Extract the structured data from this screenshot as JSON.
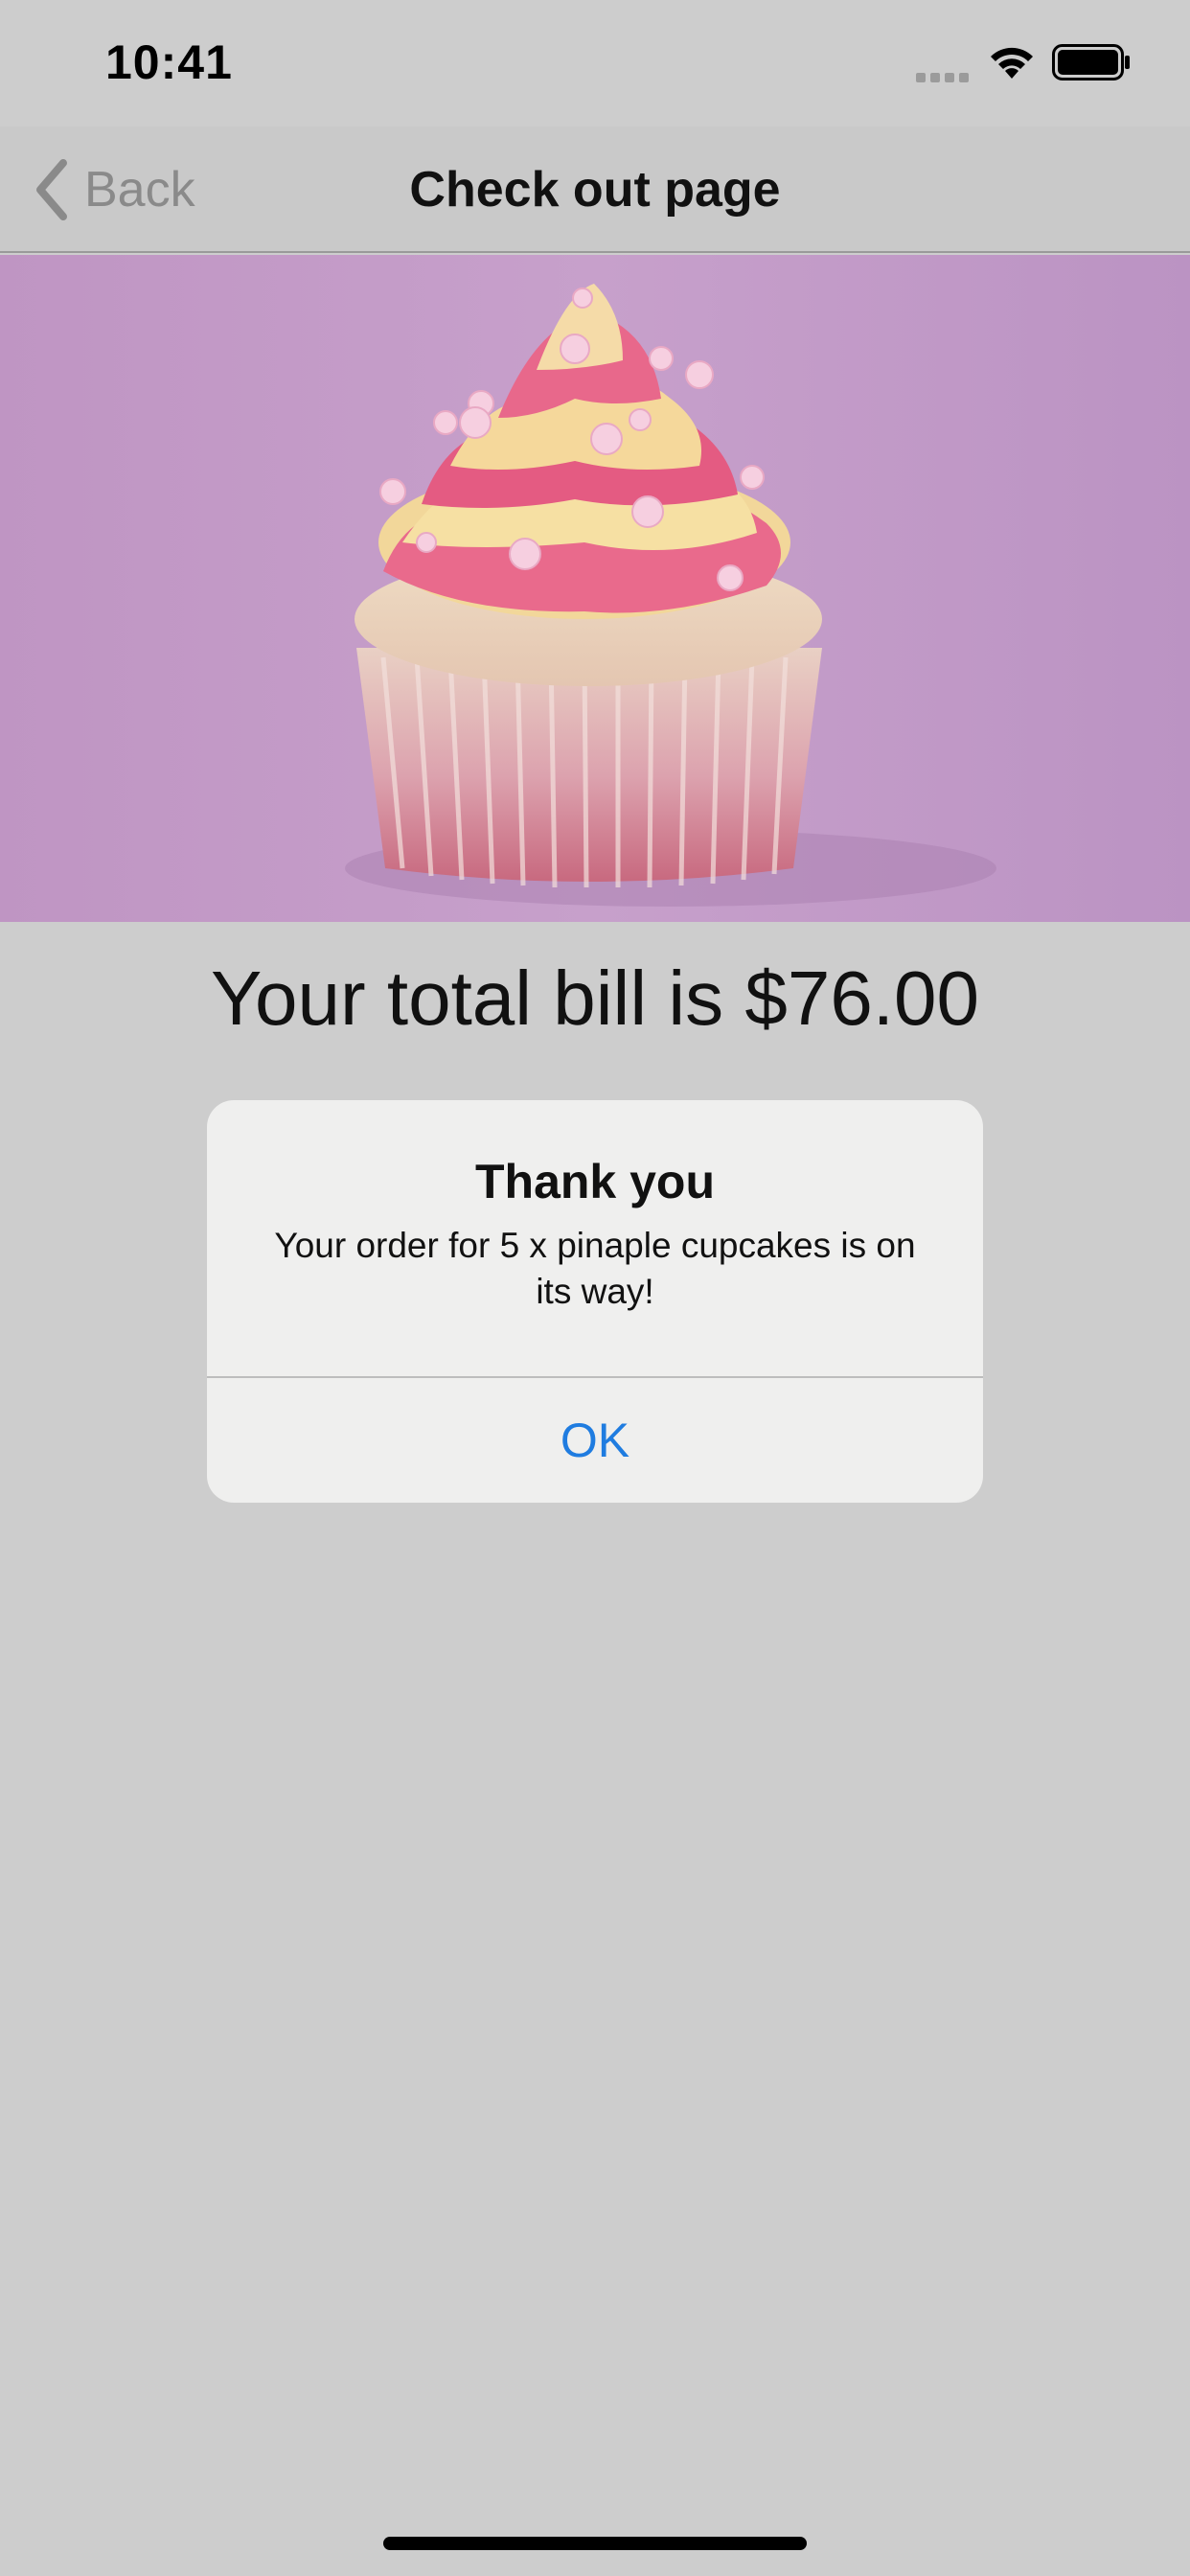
{
  "status_bar": {
    "time": "10:41",
    "icons": [
      "signal-icon",
      "wifi-icon",
      "battery-icon"
    ]
  },
  "nav": {
    "back_label": "Back",
    "back_icon": "chevron-left-icon",
    "title": "Check out page"
  },
  "hero": {
    "image": "cupcake-photo"
  },
  "total_text": "Your total bill is $76.00",
  "alert": {
    "title": "Thank you",
    "message": "Your order for 5 x pinaple cupcakes is on its way!",
    "ok_label": "OK"
  },
  "colors": {
    "background": "#cdcdcd",
    "accent": "#1f7ce0",
    "hero_background": "#c099c6"
  }
}
